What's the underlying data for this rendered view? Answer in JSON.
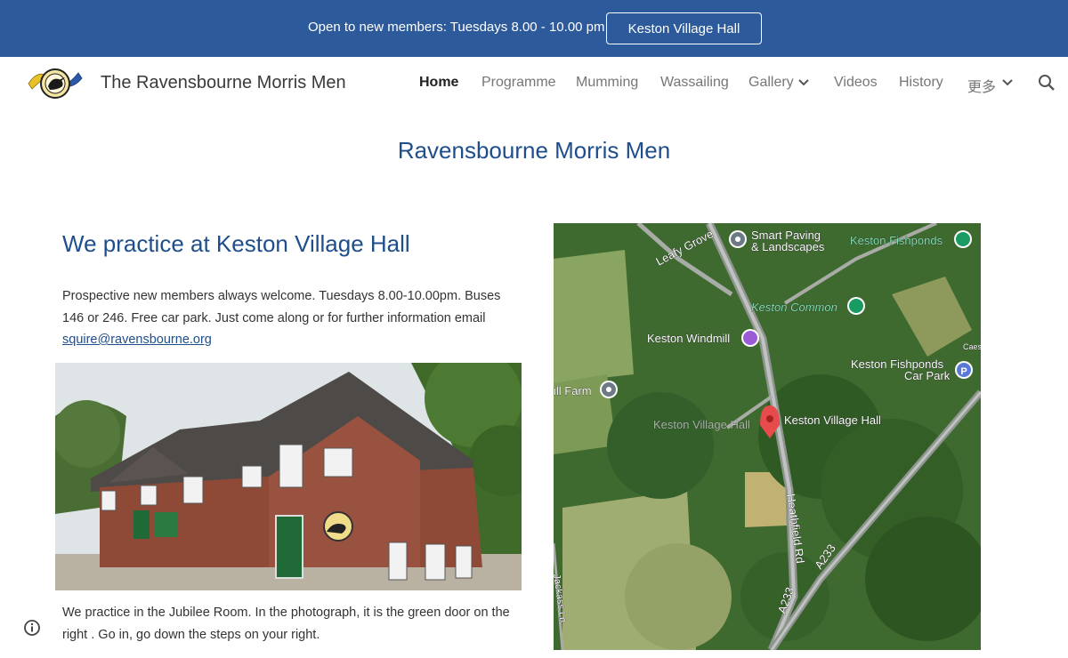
{
  "announcement": {
    "text": "Open to new members: Tuesdays 8.00 - 10.00 pm",
    "button_label": "Keston Village Hall"
  },
  "header": {
    "site_title": "The Ravensbourne Morris Men",
    "nav": [
      {
        "label": "Home",
        "active": true
      },
      {
        "label": "Programme"
      },
      {
        "label": "Mumming"
      },
      {
        "label": "Wassailing"
      },
      {
        "label": "Gallery",
        "has_dropdown": true
      },
      {
        "label": "Videos"
      },
      {
        "label": "History"
      },
      {
        "label": "更多",
        "has_dropdown": true
      }
    ]
  },
  "main": {
    "page_title": "Ravensbourne Morris Men",
    "section_heading": "We practice at Keston Village Hall",
    "intro_text": "Prospective new members always welcome. Tuesdays 8.00-10.00pm.  Buses 146 or 246. Free car park. Just come along or for further information email ",
    "email": "squire@ravensbourne.org",
    "caption": "We practice in the Jubilee Room. In the photograph, it is the green door on the right . Go in, go down the steps on your right."
  },
  "map": {
    "labels": {
      "smart_paving_1": "Smart Paving",
      "smart_paving_2": "& Landscapes",
      "keston_fishponds": "Keston Fishponds",
      "leafy_grove": "Leafy Grove",
      "keston_common": "Keston Common",
      "keston_windmill": "Keston Windmill",
      "car_park_1": "Keston Fishponds",
      "car_park_2": "Car Park",
      "mill_farm": "ill Farm",
      "village_hall_faded": "Keston Village Hall",
      "village_hall": "Keston Village Hall",
      "heathfield_rd": "Heathfield Rd",
      "a233_a": "A233",
      "a233_b": "A233",
      "jackass_ln": "Jackass Ln",
      "caes": "Caes"
    }
  },
  "colors": {
    "banner": "#2d5a9b",
    "heading": "#1e4e8c",
    "nav_text": "#767676"
  }
}
